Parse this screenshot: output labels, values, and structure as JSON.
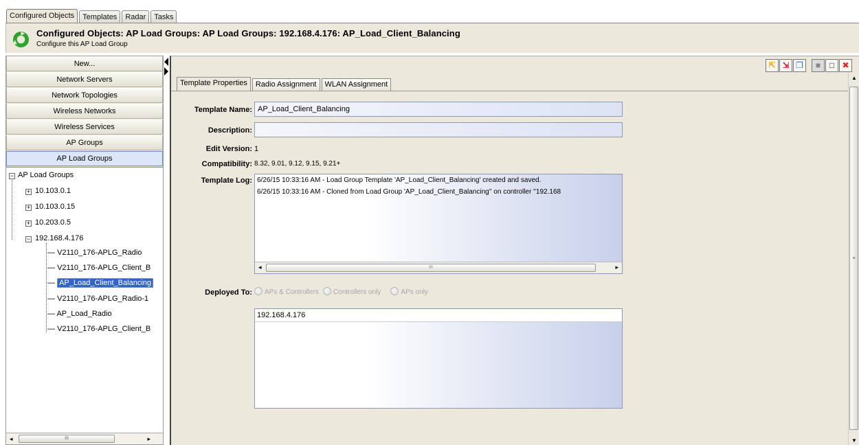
{
  "top_tabs": [
    "Configured Objects",
    "Templates",
    "Radar",
    "Tasks"
  ],
  "header": {
    "title": "Configured Objects: AP Load Groups: AP Load Groups: 192.168.4.176: AP_Load_Client_Balancing",
    "subtitle": "Configure this AP Load Group"
  },
  "nav": {
    "buttons": [
      "New...",
      "Network Servers",
      "Network Topologies",
      "Wireless Networks",
      "Wireless Services",
      "AP Groups",
      "AP Load Groups"
    ],
    "selected": "AP Load Groups"
  },
  "tree": {
    "root": "AP Load Groups",
    "nodes": [
      "10.103.0.1",
      "10.103.0.15",
      "10.203.0.5",
      "192.168.4.176"
    ],
    "children": [
      "V2110_176-APLG_Radio",
      "V2110_176-APLG_Client_B",
      "AP_Load_Client_Balancing",
      "V2110_176-APLG_Radio-1",
      "AP_Load_Radio",
      "V2110_176-APLG_Client_B"
    ],
    "selected": "AP_Load_Client_Balancing"
  },
  "scroll": {
    "grip": "III"
  },
  "toolbar_icons": [
    "export-icon",
    "import-icon",
    "copy-icon",
    "save-icon",
    "new-icon",
    "delete-icon"
  ],
  "inner_tabs": [
    "Template Properties",
    "Radio Assignment",
    "WLAN Assignment"
  ],
  "form": {
    "template_name_label": "Template Name:",
    "template_name_value": "AP_Load_Client_Balancing",
    "description_label": "Description:",
    "description_value": "",
    "edit_version_label": "Edit Version:",
    "edit_version_value": "1",
    "compatibility_label": "Compatibility:",
    "compatibility_value": "8.32, 9.01, 9.12, 9.15, 9.21+",
    "template_log_label": "Template Log:",
    "template_log": [
      "6/26/15 10:33:16 AM - Load Group Template 'AP_Load_Client_Balancing' created and saved.",
      "6/26/15 10:33:16 AM - Cloned from Load Group 'AP_Load_Client_Balancing'' on controller ''192.168"
    ],
    "deployed_to_label": "Deployed To:",
    "deployed_options": [
      "APs & Controllers",
      "Controllers only",
      "APs only"
    ],
    "deployed_list": [
      "192.168.4.176"
    ]
  }
}
